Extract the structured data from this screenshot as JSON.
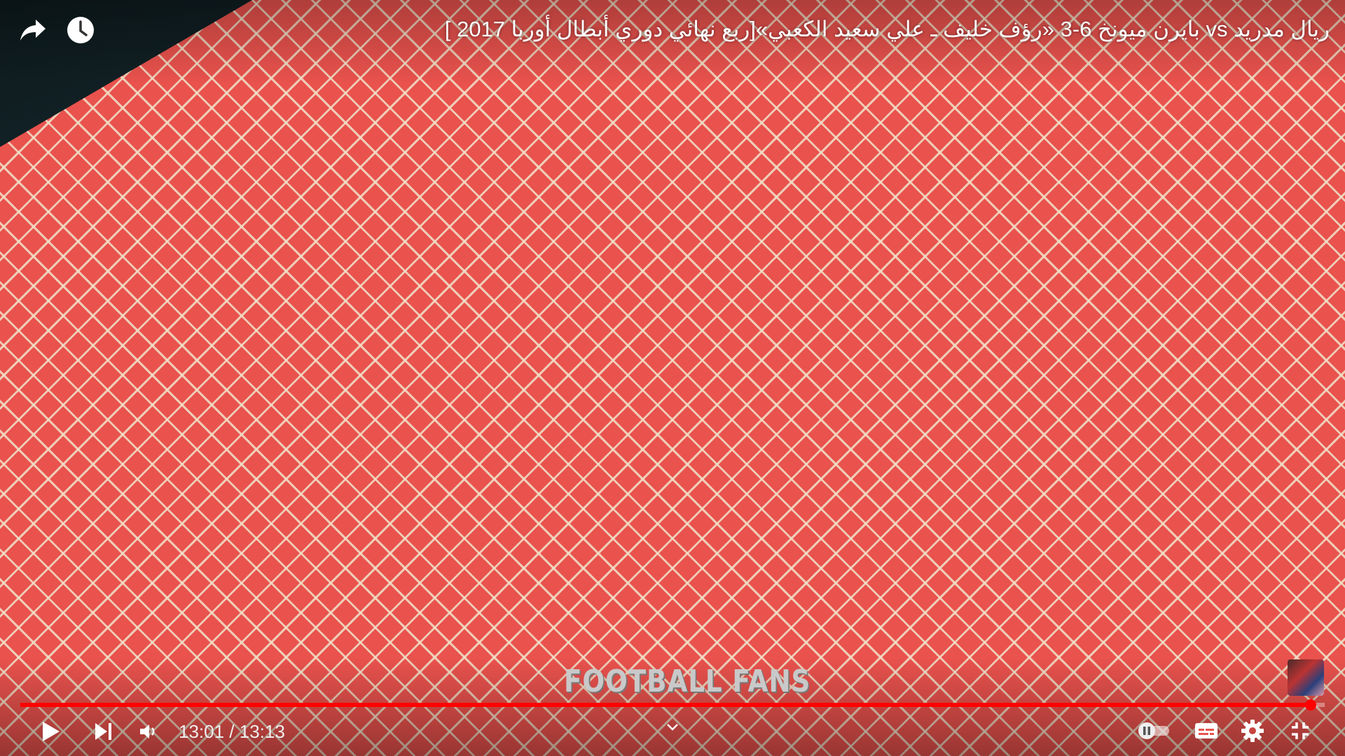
{
  "video": {
    "title": "ريال مدريد vs بايرن ميونخ 6-3 «رؤف خليف ـ علي سعيد الكعبي»[ربع نهائي دوري أبطال أوربا 2017 ]",
    "watermark": "FOOTBALL FANS",
    "progress_fraction": 0.989
  },
  "top_controls": {
    "share_icon": "share-icon",
    "watch_later_icon": "clock-icon"
  },
  "controls": {
    "current_time": "13:01",
    "separator": " / ",
    "duration": "13:13",
    "play_icon": "play-icon",
    "next_icon": "next-icon",
    "volume_icon": "volume-icon",
    "chapter_icon": "chevron-down-icon",
    "autoplay_icon": "autoplay-toggle-icon",
    "captions_icon": "captions-icon",
    "settings_icon": "gear-icon",
    "exit_fullscreen_icon": "exit-fullscreen-icon"
  },
  "colors": {
    "progress": "#ff0000",
    "background_fabric": "#e9524d",
    "icon": "#ffffff"
  }
}
